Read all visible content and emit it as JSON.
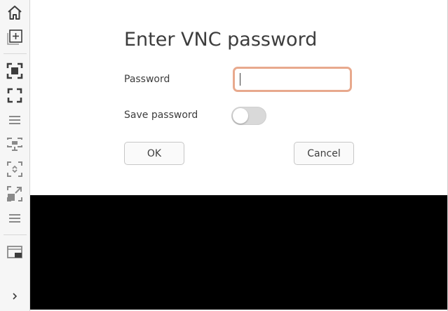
{
  "sidebar": {
    "icons": [
      {
        "name": "home-icon"
      },
      {
        "name": "new-tab-icon"
      },
      {
        "name": "fit-window-icon"
      },
      {
        "name": "fullscreen-icon"
      },
      {
        "name": "menu-icon"
      },
      {
        "name": "remote-display-icon"
      },
      {
        "name": "scale-icon"
      },
      {
        "name": "expand-icon"
      },
      {
        "name": "menu-icon"
      },
      {
        "name": "picture-in-picture-icon"
      },
      {
        "name": "chevron-right-icon"
      }
    ]
  },
  "dialog": {
    "title": "Enter VNC password",
    "password_label": "Password",
    "password_value": "",
    "save_password_label": "Save password",
    "save_password_enabled": false,
    "ok_label": "OK",
    "cancel_label": "Cancel"
  },
  "colors": {
    "input_focus_border": "#e8a98d",
    "toggle_off": "#d9d9d9",
    "remote_display": "#000000",
    "icon": "#3d3d3d"
  }
}
